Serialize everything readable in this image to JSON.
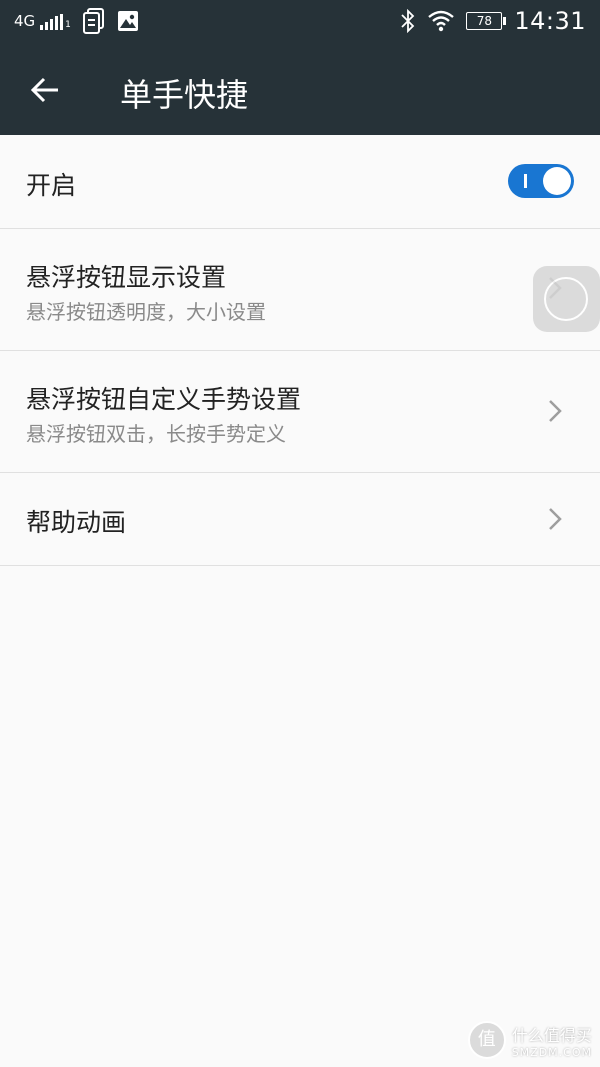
{
  "status_bar": {
    "network": "4G",
    "signal_sub": "1",
    "battery_level": "78",
    "time": "14:31",
    "icons": [
      "document-icon",
      "image-icon",
      "bluetooth-icon",
      "wifi-icon"
    ]
  },
  "app_bar": {
    "title": "单手快捷",
    "back_icon": "back-arrow-icon"
  },
  "settings": {
    "enable": {
      "label": "开启",
      "toggle_on": true,
      "accent": "#1976d2"
    },
    "float_display": {
      "title": "悬浮按钮显示设置",
      "subtitle": "悬浮按钮透明度，大小设置"
    },
    "gesture": {
      "title": "悬浮按钮自定义手势设置",
      "subtitle": "悬浮按钮双击，长按手势定义"
    },
    "help": {
      "title": "帮助动画"
    }
  },
  "watermark": {
    "seal": "值",
    "name": "什么值得买",
    "domain": "SMZDM.COM"
  },
  "colors": {
    "header_bg": "#263238",
    "page_bg": "#fafafa",
    "divider": "#e0e0e0"
  }
}
